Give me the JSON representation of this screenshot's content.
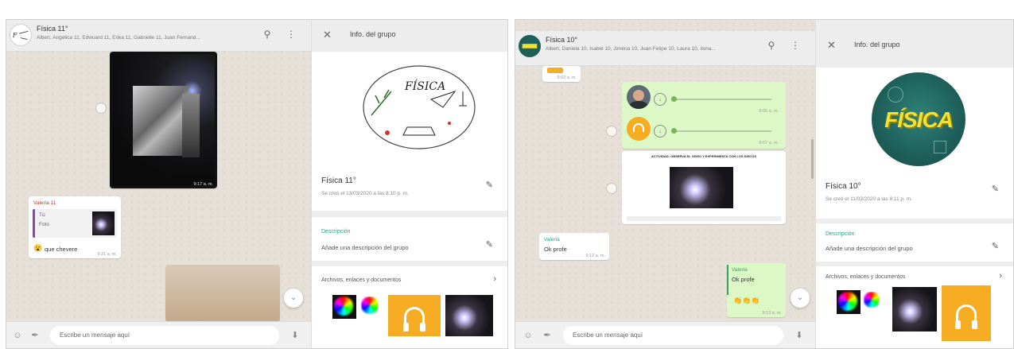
{
  "left": {
    "chat": {
      "title": "Física 11°",
      "members": "Albert, Angelica 11, Edwuard 11, Erika 11, Gabrielle 11, Juan Fernand...",
      "image_time": "9:17 a. m.",
      "reply_sender": "Valeria 11",
      "quoted_sender": "Tú",
      "quoted_text": "Foto",
      "message_emoji": "😮",
      "message_text": "que chevere",
      "message_time": "9:21 a. m.",
      "input_placeholder": "Escribe un mensaje aquí"
    },
    "info": {
      "header": "Info. del grupo",
      "logo_word": "FÍSICA",
      "group_name": "Física 11°",
      "created": "Se creó el 13/03/2020 a las 8:10 p. m.",
      "desc_label": "Descripción",
      "desc_value": "Añade una descripción del grupo",
      "media_label": "Archivos, enlaces y documentos"
    }
  },
  "right": {
    "chat": {
      "title": "Física 10°",
      "members": "Albert, Daniela 10, Isabel 10, Jimena 10, Juan Felipe 10, Laura 10, Ilona...",
      "top_time": "9:03 a. m.",
      "audio1_time": "9:06 a. m.",
      "audio2_time": "9:07 a. m.",
      "doc_caption": "ACTIVIDAD: OBSERVA EL VIDEO Y EXPERIMENTA CON LOS DISCOS",
      "incoming_sender": "Valeria",
      "incoming_text": "Ok profe",
      "incoming_time": "9:12 a. m.",
      "outgoing_sender": "Valeria",
      "outgoing_text": "Ok profe",
      "reaction": "👏👏👏",
      "outgoing_time": "9:13 a. m.",
      "input_placeholder": "Escribe un mensaje aquí"
    },
    "info": {
      "header": "Info. del grupo",
      "logo_word": "FÍSICA",
      "group_name": "Física 10°",
      "created": "Se creó el 11/03/2020 a las 8:11 p. m.",
      "desc_label": "Descripción",
      "desc_value": "Añade una descripción del grupo",
      "media_label": "Archivos, enlaces y documentos"
    }
  },
  "colors": {
    "chat_bg": "#e7e0d8",
    "outgoing_bubble": "#dcf8c6",
    "accent_teal": "#1aa88a",
    "media_orange": "#f6ac23",
    "logo_teal": "#1e5f5a",
    "logo_yellow": "#f2e233"
  },
  "icons": [
    "search-icon",
    "menu-icon",
    "close-icon",
    "pencil-icon",
    "chevron-right-icon",
    "emoji-icon",
    "attach-icon",
    "mic-icon",
    "download-icon",
    "headphones-icon",
    "chevron-down-icon"
  ]
}
